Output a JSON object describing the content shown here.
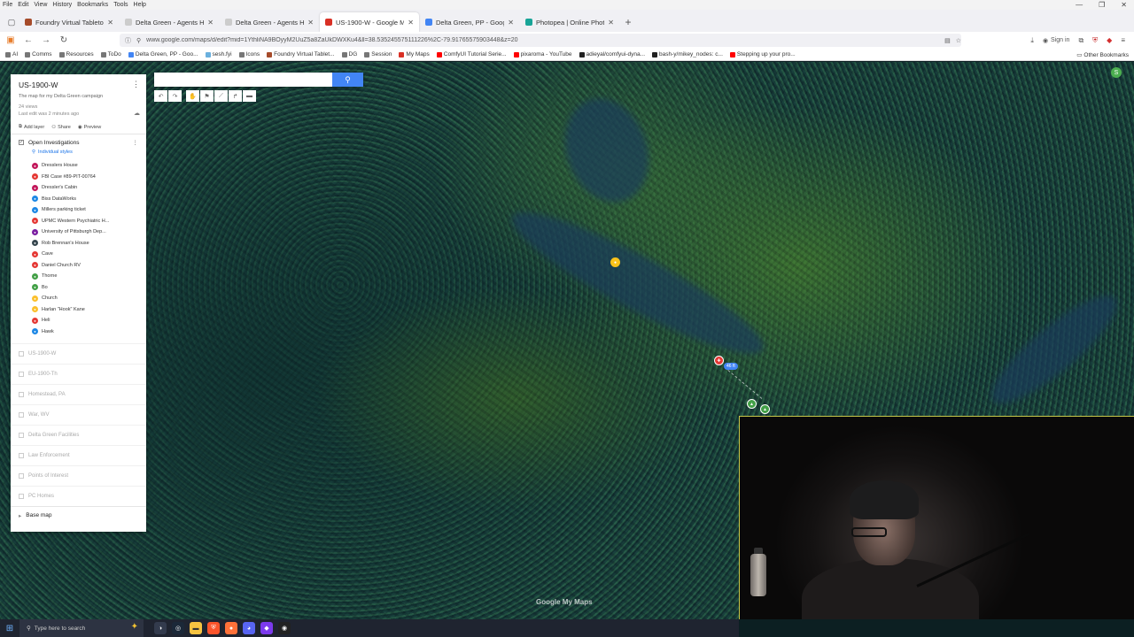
{
  "menu": [
    "File",
    "Edit",
    "View",
    "History",
    "Bookmarks",
    "Tools",
    "Help"
  ],
  "window_controls": [
    "—",
    "❐",
    "✕"
  ],
  "tabs": [
    {
      "title": "Foundry Virtual Tabletop",
      "color": "#a64b2a",
      "active": false
    },
    {
      "title": "Delta Green - Agents Handbook 20",
      "color": "#cccccc",
      "active": false
    },
    {
      "title": "Delta Green - Agents Handbook 20",
      "color": "#cccccc",
      "active": false
    },
    {
      "title": "US-1900-W - Google My Maps",
      "color": "#d93025",
      "active": true
    },
    {
      "title": "Delta Green, PP - Google Earth",
      "color": "#4285f4",
      "active": false
    },
    {
      "title": "Photopea | Online Photo Editor",
      "color": "#18a497",
      "active": false
    }
  ],
  "url": "www.google.com/maps/d/edit?mid=1YthliNA9BOyyM2UuZ5a8ZaUkDWXKu4&ll=38.535245575111226%2C-79.91765575903448&z=20",
  "signin_label": "Sign in",
  "bookmarks": [
    {
      "label": "AI",
      "color": "#777"
    },
    {
      "label": "Comms",
      "color": "#777"
    },
    {
      "label": "Resources",
      "color": "#777"
    },
    {
      "label": "ToDo",
      "color": "#777"
    },
    {
      "label": "Delta Green, PP - Goo...",
      "color": "#4285f4"
    },
    {
      "label": "sesh.fyi",
      "color": "#6ab0de"
    },
    {
      "label": "Icons",
      "color": "#777"
    },
    {
      "label": "Foundry Virtual Tablet...",
      "color": "#a64b2a"
    },
    {
      "label": "DG",
      "color": "#777"
    },
    {
      "label": "Session",
      "color": "#777"
    },
    {
      "label": "My Maps",
      "color": "#d93025"
    },
    {
      "label": "ComfyUI Tutorial Serie...",
      "color": "#ff0000"
    },
    {
      "label": "pixaroma - YouTube",
      "color": "#ff0000"
    },
    {
      "label": "adieyal/comfyui-dyna...",
      "color": "#222"
    },
    {
      "label": "bash-y/mikey_nodes: c...",
      "color": "#222"
    },
    {
      "label": "Stepping up your pro...",
      "color": "#ff0000"
    }
  ],
  "other_bookmarks": "Other Bookmarks",
  "map": {
    "search_placeholder": "",
    "title": "US-1900-W",
    "description": "The map for my Delta Green campaign",
    "views": "24 views",
    "last_edit": "Last edit was 2 minutes ago",
    "actions": {
      "add_layer": "Add layer",
      "share": "Share",
      "preview": "Preview"
    },
    "layer": {
      "name": "Open Investigations",
      "style": "Individual styles",
      "places": [
        {
          "label": "Dresslers House",
          "color": "#c2185b"
        },
        {
          "label": "FBI Case #89-PIT-00764",
          "color": "#e53935"
        },
        {
          "label": "Dressler's Cabin",
          "color": "#c2185b"
        },
        {
          "label": "Biss DataWorks",
          "color": "#1e88e5"
        },
        {
          "label": "Millers parking ticket",
          "color": "#1e88e5"
        },
        {
          "label": "UPMC Western Psychiatric H...",
          "color": "#e53935"
        },
        {
          "label": "University of Pittsburgh Dep...",
          "color": "#7b1fa2"
        },
        {
          "label": "Rob Brennan's House",
          "color": "#37474f"
        },
        {
          "label": "Cave",
          "color": "#e53935"
        },
        {
          "label": "Daniel Church RV",
          "color": "#e53935"
        },
        {
          "label": "Thorne",
          "color": "#43a047"
        },
        {
          "label": "Bo",
          "color": "#43a047"
        },
        {
          "label": "Church",
          "color": "#fbc02d"
        },
        {
          "label": "Harlan \"Hook\" Kane",
          "color": "#fbc02d"
        },
        {
          "label": "Heli",
          "color": "#e53935"
        },
        {
          "label": "Hawk",
          "color": "#1e88e5"
        }
      ]
    },
    "other_layers": [
      "US-1900-W",
      "EU-1900-Th",
      "Homestead, PA",
      "War, WV",
      "Delta Green Facilities",
      "Law Enforcement",
      "Points of Interest",
      "PC Homes"
    ],
    "base_map": "Base map",
    "distance_badge": "46 ft",
    "watermark": "Google My Maps",
    "avatar_letter": "S"
  },
  "taskbar": {
    "search_placeholder": "Type here to search"
  }
}
